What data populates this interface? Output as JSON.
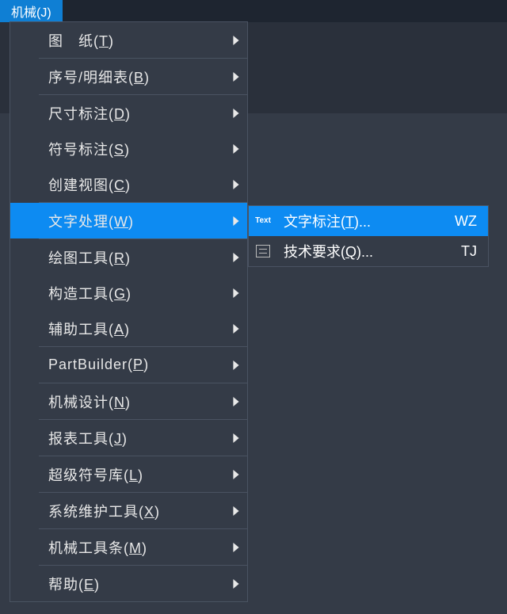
{
  "topMenu": {
    "label": "机械(J)"
  },
  "mainMenu": [
    {
      "text": "图　纸(",
      "hk": "T",
      "suffix": ")",
      "sep": true
    },
    {
      "text": "序号/明细表(",
      "hk": "B",
      "suffix": ")",
      "sep": true
    },
    {
      "text": "尺寸标注(",
      "hk": "D",
      "suffix": ")",
      "sep": false
    },
    {
      "text": "符号标注(",
      "hk": "S",
      "suffix": ")",
      "sep": false
    },
    {
      "text": "创建视图(",
      "hk": "C",
      "suffix": ")",
      "sep": true
    },
    {
      "text": "文字处理(",
      "hk": "W",
      "suffix": ")",
      "sep": true,
      "highlight": true
    },
    {
      "text": "绘图工具(",
      "hk": "R",
      "suffix": ")",
      "sep": false
    },
    {
      "text": "构造工具(",
      "hk": "G",
      "suffix": ")",
      "sep": false
    },
    {
      "text": "辅助工具(",
      "hk": "A",
      "suffix": ")",
      "sep": true
    },
    {
      "text": "PartBuilder(",
      "hk": "P",
      "suffix": ")",
      "sep": true
    },
    {
      "text": "机械设计(",
      "hk": "N",
      "suffix": ")",
      "sep": true
    },
    {
      "text": "报表工具(",
      "hk": "J",
      "suffix": ")",
      "sep": true
    },
    {
      "text": "超级符号库(",
      "hk": "L",
      "suffix": ")",
      "sep": true
    },
    {
      "text": "系统维护工具(",
      "hk": "X",
      "suffix": ")",
      "sep": true
    },
    {
      "text": "机械工具条(",
      "hk": "M",
      "suffix": ")",
      "sep": true
    },
    {
      "text": "帮助(",
      "hk": "E",
      "suffix": ")",
      "sep": false
    }
  ],
  "subMenu": [
    {
      "icon": "text",
      "text": "文字标注(",
      "hk": "T",
      "suffix": ")...",
      "shortcut": "WZ",
      "highlight": true
    },
    {
      "icon": "rect",
      "text": "技术要求(",
      "hk": "Q",
      "suffix": ")...",
      "shortcut": "TJ",
      "highlight": false
    }
  ]
}
